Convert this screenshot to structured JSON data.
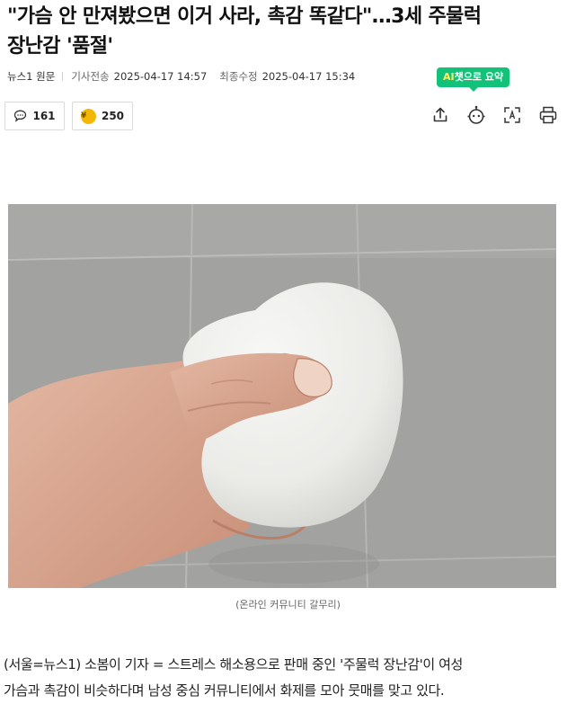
{
  "article": {
    "headline_line1": "\"가슴 안 만져봤으면 이거 사라, 촉감 똑같다\"…3세 주물럭",
    "headline_line2": "장난감 '품절'",
    "press": "뉴스1",
    "press_link": "원문",
    "sent_label": "기사전송",
    "sent_time": "2025-04-17 14:57",
    "modified_label": "최종수정",
    "modified_time": "2025-04-17 15:34",
    "caption": "(온라인 커뮤니티 갈무리)",
    "body_line1": "(서울=뉴스1) 소봄이 기자 = 스트레스 해소용으로 판매 중인 '주물럭 장난감'이 여성",
    "body_line2": "가슴과 촉감이 비슷하다며 남성 중심 커뮤니티에서 화제를 모아 뭇매를 맞고 있다."
  },
  "ai_summary": {
    "ai": "AI",
    "rest": "챗으로 요약"
  },
  "reactions": {
    "comments": "161",
    "rewards": "250",
    "coin_symbol": "¥"
  },
  "toolbar": {
    "icons": [
      "share-icon",
      "chatbot-icon",
      "font-size-icon",
      "print-icon"
    ]
  },
  "colors": {
    "accent_green": "#12c278",
    "ai_yellow": "#fff36b",
    "coin_gold": "#f2b705"
  }
}
